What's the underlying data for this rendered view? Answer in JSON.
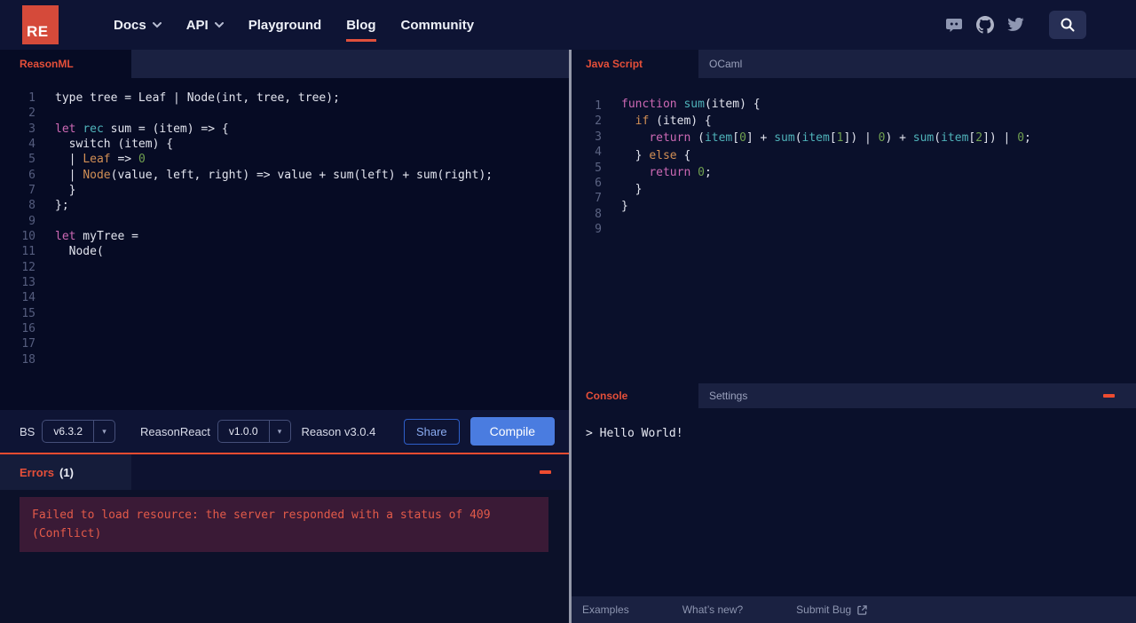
{
  "colors": {
    "accent_red": "#ee4c30",
    "active_tab_red": "#e54f39",
    "logo_red": "#d54a3a",
    "compile_blue": "#4a7ce0",
    "share_blue": "#8aabf0",
    "error_text": "#e25a49",
    "error_box_bg": "#3a1a36",
    "code_keyword_pink": "#cd69b4",
    "code_ident_teal": "#4fb3ba",
    "code_variant_orange": "#d28f55",
    "code_number_green": "#70a050",
    "editor_bg_left": "#060b24",
    "editor_bg_right": "#0a102b",
    "page_bg": "#0e1434"
  },
  "nav": {
    "logo_text": "RE",
    "items": [
      {
        "label": "Docs",
        "caret": true
      },
      {
        "label": "API",
        "caret": true
      },
      {
        "label": "Playground"
      },
      {
        "label": "Blog",
        "active": true
      },
      {
        "label": "Community"
      }
    ],
    "social_icons": [
      "discord-icon",
      "github-icon",
      "twitter-icon"
    ],
    "search_icon": "search-icon"
  },
  "left_editor": {
    "tab_label": "ReasonML",
    "lines": [
      [
        [
          "p",
          "type tree = Leaf | Node(int, tree, tree);"
        ]
      ],
      [],
      [
        [
          "k",
          "let"
        ],
        [
          "p",
          " "
        ],
        [
          "t",
          "rec"
        ],
        [
          "p",
          " sum = (item) => {"
        ]
      ],
      [
        [
          "p",
          "  switch (item) {"
        ]
      ],
      [
        [
          "p",
          "  | "
        ],
        [
          "o",
          "Leaf"
        ],
        [
          "p",
          " => "
        ],
        [
          "g",
          "0"
        ]
      ],
      [
        [
          "p",
          "  | "
        ],
        [
          "o",
          "Node"
        ],
        [
          "p",
          "(value, left, right) => value + sum(left) + sum(right);"
        ]
      ],
      [
        [
          "p",
          "  }"
        ]
      ],
      [
        [
          "p",
          "};"
        ]
      ],
      [],
      [
        [
          "k",
          "let"
        ],
        [
          "p",
          " myTree ="
        ]
      ],
      [
        [
          "p",
          "  Node("
        ]
      ],
      [],
      [],
      [],
      [],
      [],
      [],
      []
    ]
  },
  "right_editor": {
    "tabs": [
      {
        "label": "Java Script",
        "active": true
      },
      {
        "label": "OCaml"
      }
    ],
    "lines": [
      [
        [
          "k",
          "function"
        ],
        [
          "p",
          " "
        ],
        [
          "t",
          "sum"
        ],
        [
          "p",
          "(item) {"
        ]
      ],
      [
        [
          "p",
          "  "
        ],
        [
          "o",
          "if"
        ],
        [
          "p",
          " (item) {"
        ]
      ],
      [
        [
          "p",
          "    "
        ],
        [
          "k",
          "return"
        ],
        [
          "p",
          " ("
        ],
        [
          "t",
          "item"
        ],
        [
          "p",
          "["
        ],
        [
          "g",
          "0"
        ],
        [
          "p",
          "] + "
        ],
        [
          "t",
          "sum"
        ],
        [
          "p",
          "("
        ],
        [
          "t",
          "item"
        ],
        [
          "p",
          "["
        ],
        [
          "g",
          "1"
        ],
        [
          "p",
          "]) | "
        ],
        [
          "g",
          "0"
        ],
        [
          "p",
          ") + "
        ],
        [
          "t",
          "sum"
        ],
        [
          "p",
          "("
        ],
        [
          "t",
          "item"
        ],
        [
          "p",
          "["
        ],
        [
          "g",
          "2"
        ],
        [
          "p",
          "]) | "
        ],
        [
          "g",
          "0"
        ],
        [
          "p",
          ";"
        ]
      ],
      [
        [
          "p",
          "  } "
        ],
        [
          "o",
          "else"
        ],
        [
          "p",
          " {"
        ]
      ],
      [
        [
          "p",
          "    "
        ],
        [
          "k",
          "return"
        ],
        [
          "p",
          " "
        ],
        [
          "g",
          "0"
        ],
        [
          "p",
          ";"
        ]
      ],
      [
        [
          "p",
          "  }"
        ]
      ],
      [
        [
          "p",
          "}"
        ]
      ],
      [],
      []
    ]
  },
  "toolbar": {
    "bs_label": "BS",
    "bs_version": "v6.3.2",
    "reasonreact_label": "ReasonReact",
    "reasonreact_version": "v1.0.0",
    "reason_version_text": "Reason v3.0.4",
    "share_label": "Share",
    "compile_label": "Compile"
  },
  "errors_panel": {
    "title": "Errors",
    "count": "(1)",
    "message": "Failed to load resource: the server responded with a status of 409 (Conflict)"
  },
  "console_panel": {
    "tabs": [
      {
        "label": "Console",
        "active": true
      },
      {
        "label": "Settings"
      }
    ],
    "output": "> Hello World!"
  },
  "footer": {
    "links": [
      "Examples",
      "What’s new?",
      "Submit Bug"
    ]
  }
}
